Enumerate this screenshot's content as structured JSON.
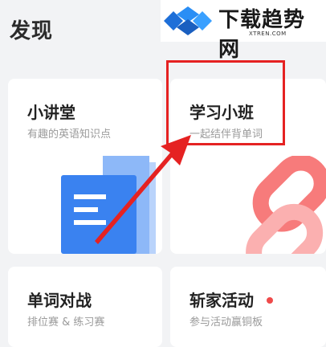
{
  "page": {
    "title": "发现"
  },
  "watermark": {
    "brand": "下载趋势网",
    "url": "XTREN.COM"
  },
  "cards": [
    {
      "id": "lecture",
      "title": "小讲堂",
      "subtitle": "有趣的英语知识点"
    },
    {
      "id": "class",
      "title": "学习小班",
      "subtitle": "一起结伴背单词"
    },
    {
      "id": "battle",
      "title": "单词对战",
      "subtitle": "排位赛 & 练习赛"
    },
    {
      "id": "activity",
      "title": "斩家活动",
      "subtitle": "参与活动赢铜板"
    }
  ],
  "colors": {
    "background": "#f2f3f5",
    "card": "#ffffff",
    "annotation_red": "#e52222",
    "doc_blue": "#3a82f0",
    "link_pink": "#f77b7b",
    "notice_dot": "#ef4a4a"
  },
  "icons": {
    "lecture": "document-icon",
    "class": "chain-link-icon",
    "watermark": "brand-logo-icon"
  }
}
